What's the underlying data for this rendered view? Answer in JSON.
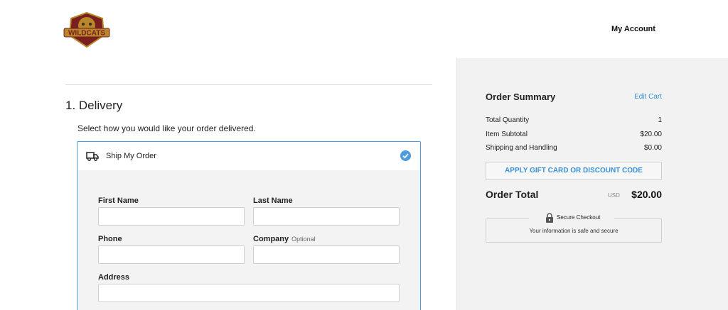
{
  "header": {
    "account_label": "My Account",
    "logo_text": "WILDCATS",
    "logo_colors": {
      "primary": "#b8862b",
      "secondary": "#7a1f1f"
    }
  },
  "delivery": {
    "title": "1. Delivery",
    "description": "Select how you would like your order delivered.",
    "option": {
      "label": "Ship My Order",
      "selected": true
    },
    "fields": {
      "first_name": {
        "label": "First Name",
        "value": ""
      },
      "last_name": {
        "label": "Last Name",
        "value": ""
      },
      "phone": {
        "label": "Phone",
        "value": ""
      },
      "company": {
        "label": "Company",
        "hint": "Optional",
        "value": ""
      },
      "address": {
        "label": "Address",
        "value": ""
      }
    }
  },
  "summary": {
    "title": "Order Summary",
    "edit_cart": "Edit Cart",
    "rows": [
      {
        "label": "Total Quantity",
        "value": "1"
      },
      {
        "label": "Item Subtotal",
        "value": "$20.00"
      },
      {
        "label": "Shipping and Handling",
        "value": "$0.00"
      }
    ],
    "gift_button": "APPLY GIFT CARD OR DISCOUNT CODE",
    "total_label": "Order Total",
    "currency": "USD",
    "total_value": "$20.00",
    "secure_title": "Secure Checkout",
    "secure_sub": "Your information is safe and secure"
  },
  "colors": {
    "accent": "#3b8fd6",
    "panel": "#f2f2f2",
    "border": "#cfcfcf"
  }
}
